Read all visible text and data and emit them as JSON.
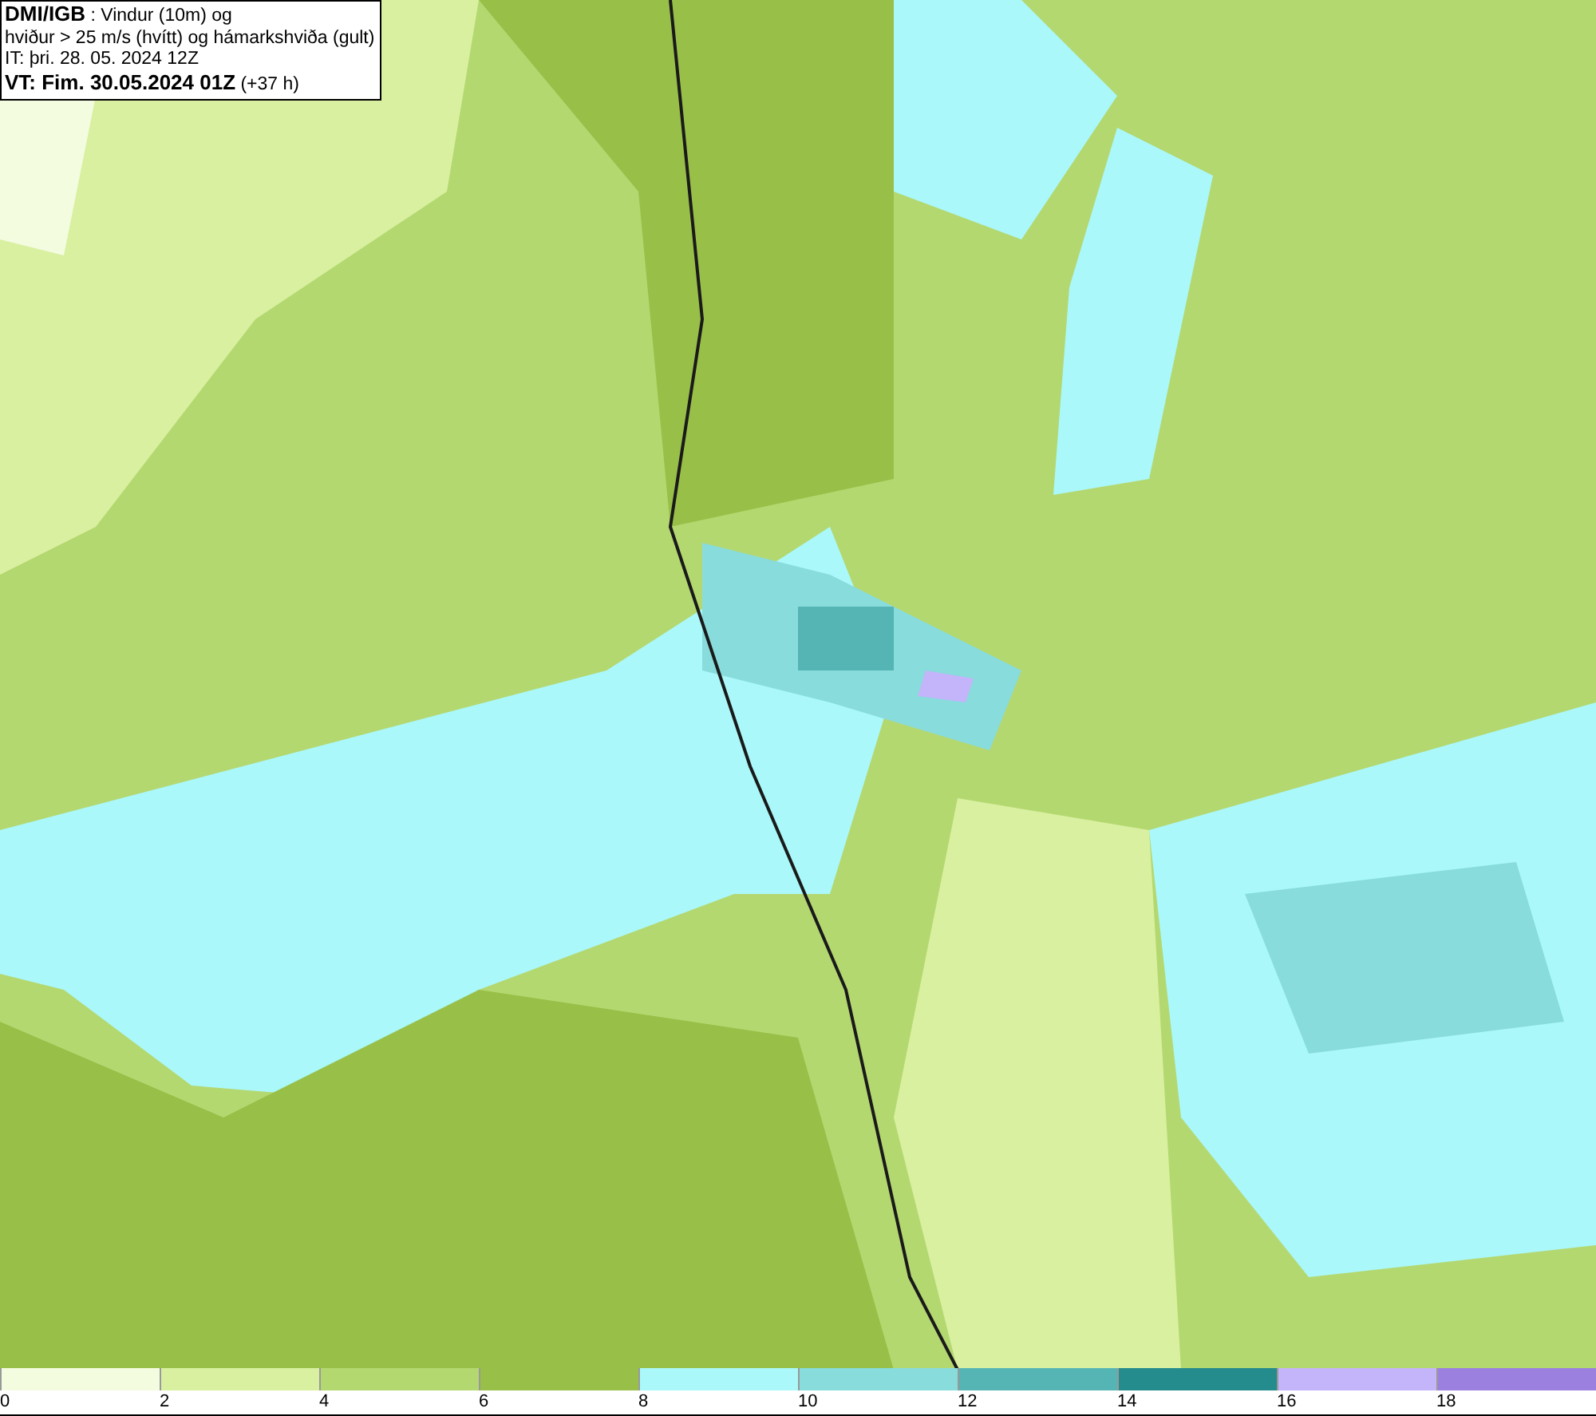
{
  "title_box": {
    "lines": [
      "**DMI/IGB** : Vindur (10m) og",
      "hviður > 25 m/s (hvítt) og hámarkshviða (gult)",
      "IT: þri. 28. 05. 2024 12Z",
      "**VT: Fim. 30.05.2024 01Z** (+37 h)"
    ]
  },
  "legend": [
    {
      "label": "0",
      "color": "#f4fce0"
    },
    {
      "label": "2",
      "color": "#d8f0a0"
    },
    {
      "label": "4",
      "color": "#b4d870"
    },
    {
      "label": "6",
      "color": "#98c048"
    },
    {
      "label": "8",
      "color": "#aaf8fa"
    },
    {
      "label": "10",
      "color": "#88dcdc"
    },
    {
      "label": "12",
      "color": "#55b4b4"
    },
    {
      "label": "14",
      "color": "#248c8c"
    },
    {
      "label": "16",
      "color": "#c4b4fa"
    },
    {
      "label": "18",
      "color": "#9b80e0"
    }
  ]
}
